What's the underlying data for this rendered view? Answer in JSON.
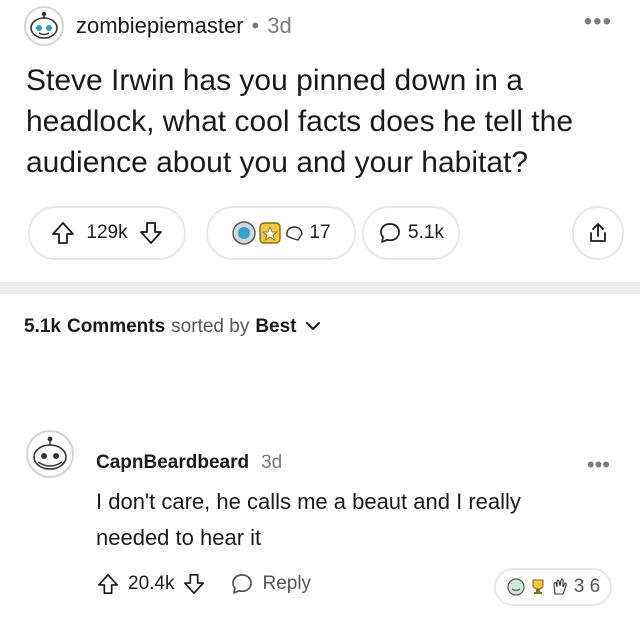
{
  "post": {
    "author": "zombiepiemaster",
    "separator": "•",
    "age": "3d",
    "title": "Steve Irwin has you pinned down in a headlock, what cool facts does he tell the audience about you and your habitat?",
    "more_icon": "ellipsis-icon",
    "votes": "129k",
    "award_count": "17",
    "comments": "5.1k"
  },
  "sort": {
    "count": "5.1k",
    "label": "Comments",
    "middle": "sorted by",
    "value": "Best"
  },
  "comment": {
    "author": "CapnBeardbeard",
    "age": "3d",
    "body": "I don't care, he calls me a beaut and I really needed to hear it",
    "votes": "20.4k",
    "reply_label": "Reply",
    "award_count": "3 6"
  },
  "colors": {
    "text": "#1a1a1b",
    "muted": "#7c7c7c",
    "border": "#e6e8ea",
    "divider": "#eaeced"
  }
}
